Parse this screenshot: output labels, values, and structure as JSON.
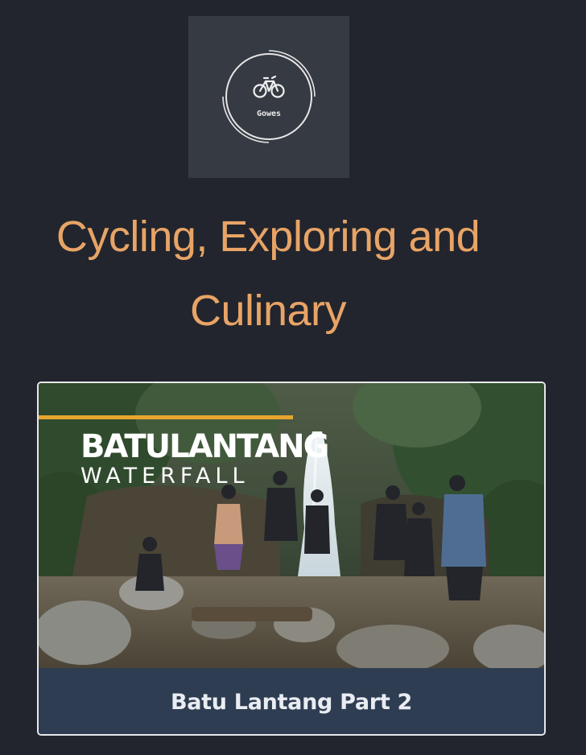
{
  "logo": {
    "name": "Gowes",
    "icon": "bicycle-icon"
  },
  "headline": {
    "line1": "Cycling, Exploring and",
    "line2": "Culinary"
  },
  "video_card": {
    "overlay_title": "BATULANTANG",
    "overlay_subtitle": "WATERFALL",
    "caption": "Batu Lantang Part 2"
  },
  "colors": {
    "background": "#22252d",
    "logo_box": "#363a43",
    "headline": "#e8a466",
    "caption_bar": "#2f3d52",
    "caption_text": "#e9edf2",
    "accent_line": "#e6a52f"
  }
}
